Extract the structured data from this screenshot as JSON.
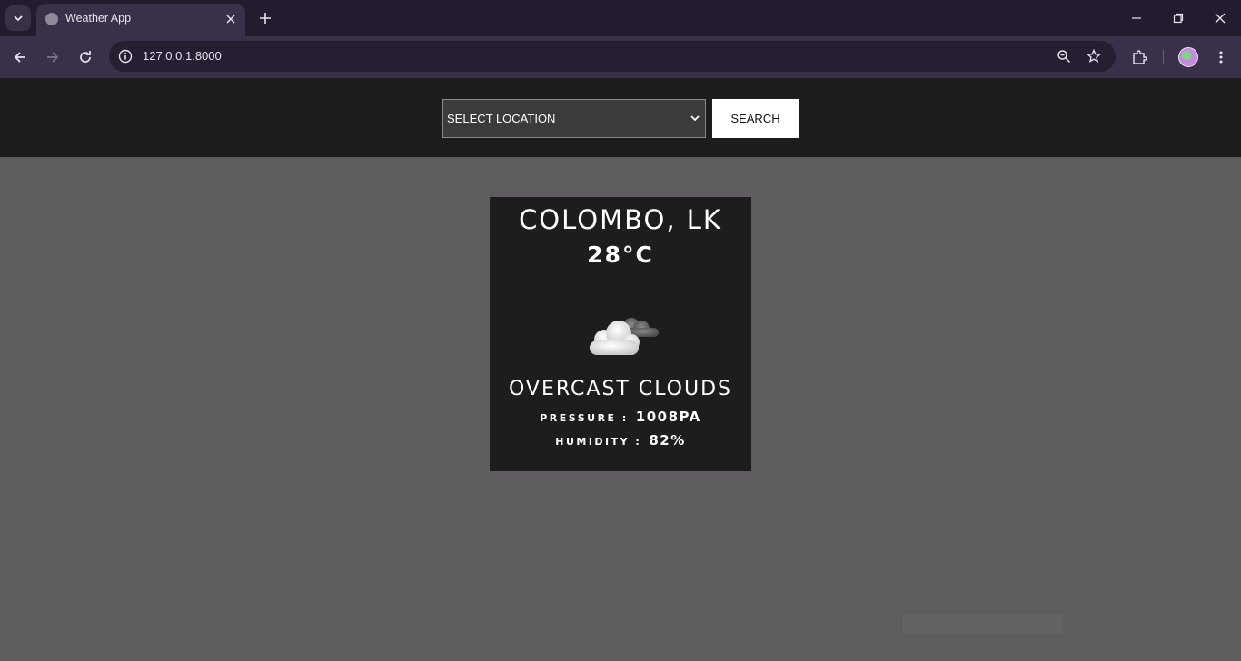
{
  "browser": {
    "tab_title": "Weather App",
    "url": "127.0.0.1:8000"
  },
  "header": {
    "select_value": "SELECT LOCATION",
    "search_label": "SEARCH"
  },
  "weather": {
    "city": "COLOMBO, LK",
    "temperature": "28°C",
    "icon": "overcast-clouds-icon",
    "description": "OVERCAST CLOUDS",
    "pressure_label": "PRESSURE :",
    "pressure_value": "1008PA",
    "humidity_label": "HUMIDITY :",
    "humidity_value": "82%"
  },
  "colors": {
    "page_background": "#5e5c5f",
    "header_background": "#1c1c1c",
    "card_background": "#1d1d1d",
    "chrome_tabstrip": "#231c2e",
    "chrome_toolbar": "#3b3049"
  }
}
